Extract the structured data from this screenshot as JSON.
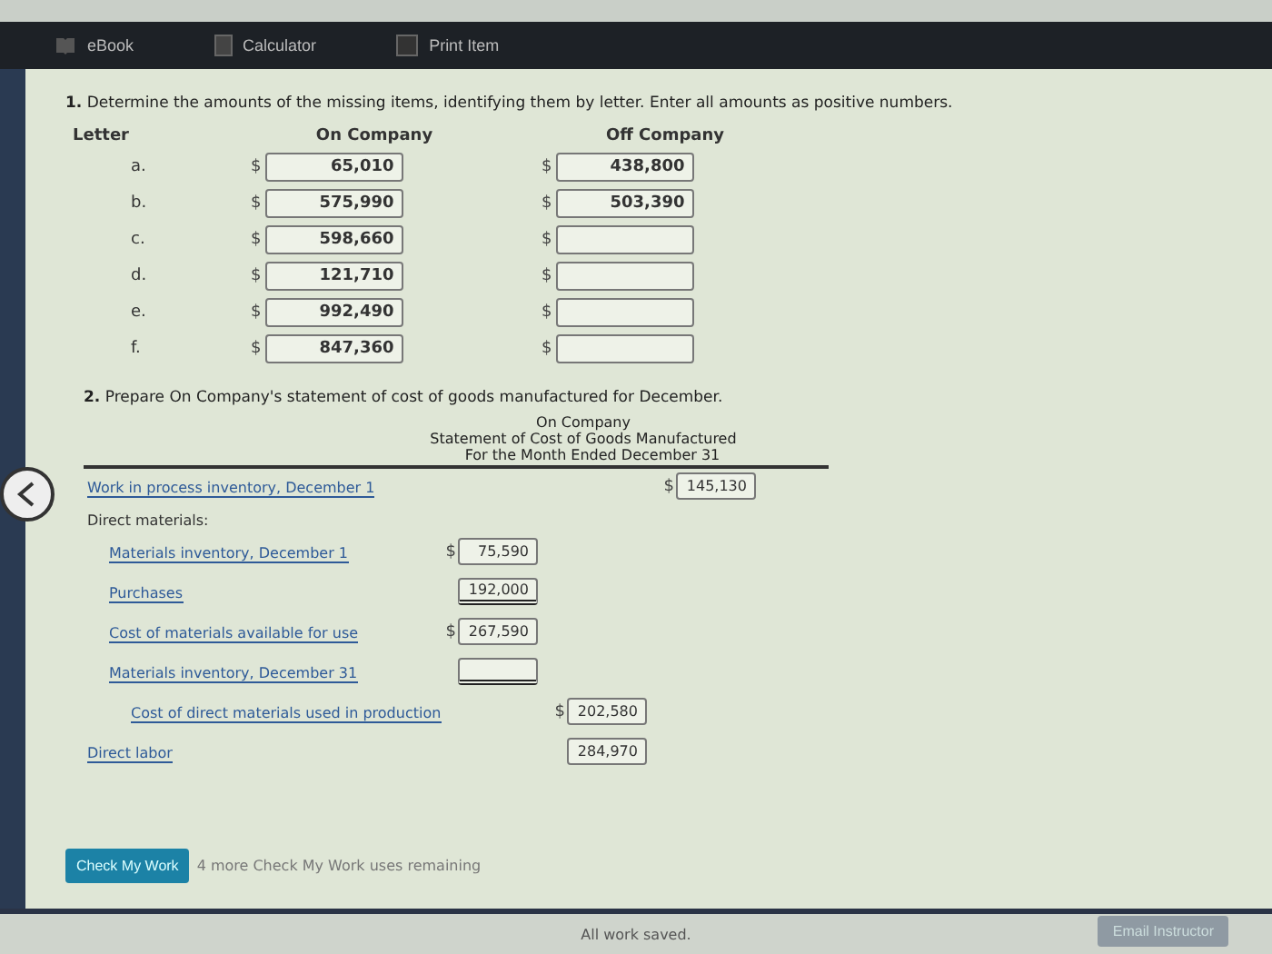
{
  "toolbar": {
    "tabs": [
      {
        "label": "eBook",
        "kind": "book"
      },
      {
        "label": "Calculator",
        "kind": "calculator"
      },
      {
        "label": "Print Item",
        "kind": "print"
      }
    ]
  },
  "part1": {
    "number": "1.",
    "instruction": "Determine the amounts of the missing items, identifying them by letter. Enter all amounts as positive numbers.",
    "columns": [
      "Letter",
      "On Company",
      "Off Company"
    ],
    "rows": [
      {
        "letter": "a.",
        "on_currency": "$",
        "on": "65,010",
        "off_currency": "$",
        "off": "438,800"
      },
      {
        "letter": "b.",
        "on_currency": "$",
        "on": "575,990",
        "off_currency": "$",
        "off": "503,390"
      },
      {
        "letter": "c.",
        "on_currency": "$",
        "on": "598,660",
        "off_currency": "$"
      },
      {
        "letter": "d.",
        "on_currency": "$",
        "on": "121,710",
        "off_currency": "$"
      },
      {
        "letter": "e.",
        "on_currency": "$",
        "on": "992,490",
        "off_currency": "$"
      },
      {
        "letter": "f.",
        "on_currency": "$",
        "on": "847,360",
        "off_currency": "$"
      }
    ]
  },
  "part2": {
    "number": "2.",
    "instruction": "Prepare On Company's statement of cost of goods manufactured for December.",
    "company": "On Company",
    "title": "Statement of Cost of Goods Manufactured",
    "period": "For the Month Ended December 31",
    "lines": [
      {
        "kind": "outer",
        "label": "Work in process inventory, December 1",
        "currency": "$",
        "value": "145,130",
        "rule_below": false
      },
      {
        "kind": "heading",
        "label": "Direct materials:",
        "children": [
          {
            "kind": "inner",
            "label": "Materials inventory, December 1",
            "currency": "$",
            "value": "75,590",
            "rule_below": false
          },
          {
            "kind": "inner",
            "label": "Purchases",
            "value": "192,000",
            "rule_below": true
          },
          {
            "kind": "inner",
            "label": "Cost of materials available for use",
            "currency": "$",
            "value": "267,590",
            "rule_below": false
          },
          {
            "kind": "inner",
            "label": "Materials inventory, December 31",
            "rule_below": true
          },
          {
            "kind": "subtotal",
            "label": "Cost of direct materials used in production",
            "currency": "$",
            "value": "202,580",
            "rule_below": false
          }
        ]
      },
      {
        "kind": "middle",
        "label": "Direct labor",
        "value": "284,970",
        "rule_below": false
      }
    ]
  },
  "check": {
    "button": "Check My Work",
    "note": "4 more Check My Work uses remaining"
  },
  "footer": {
    "status": "All work saved.",
    "button": "Email Instructor"
  }
}
